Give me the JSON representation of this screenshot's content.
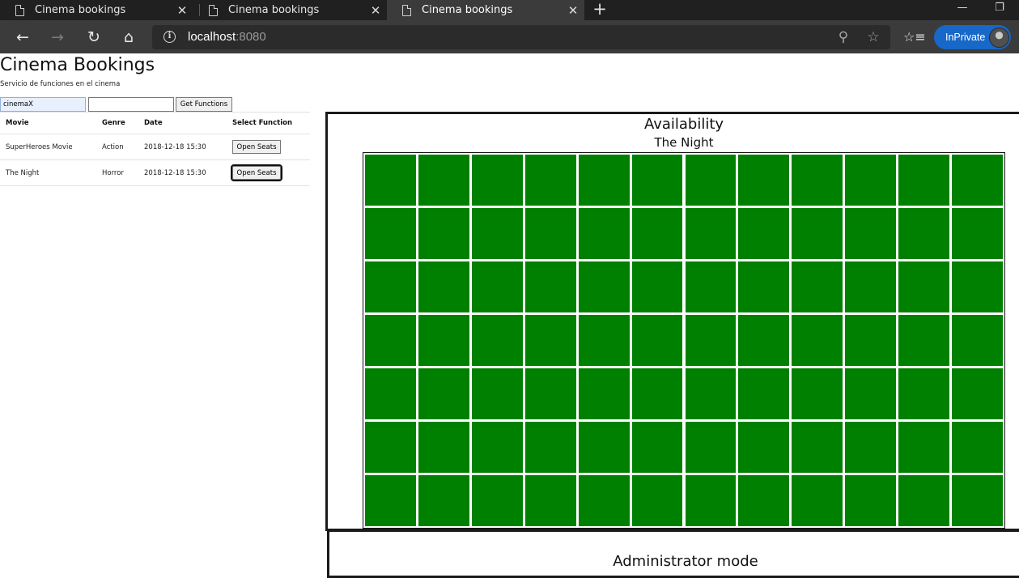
{
  "browser": {
    "tabs": [
      {
        "title": "Cinema bookings",
        "active": false
      },
      {
        "title": "Cinema bookings",
        "active": false
      },
      {
        "title": "Cinema bookings",
        "active": true
      }
    ],
    "url_host": "localhost",
    "url_port": ":8080",
    "inprivate_label": "InPrivate",
    "icons": {
      "tab": "page-icon",
      "close": "close-icon",
      "new_tab": "plus-icon",
      "back": "back-arrow-icon",
      "forward": "forward-arrow-icon",
      "refresh": "refresh-icon",
      "home": "home-icon",
      "site_info": "info-icon",
      "zoom": "zoom-icon",
      "favorite": "star-icon",
      "favorites_list": "favorites-icon"
    }
  },
  "page": {
    "title": "Cinema Bookings",
    "subtitle": "Servicio de funciones en el cinema",
    "cinema_input_value": "cinemaX",
    "date_input_value": "",
    "get_functions_label": "Get Functions",
    "table": {
      "headers": {
        "movie": "Movie",
        "genre": "Genre",
        "date": "Date",
        "select": "Select Function"
      },
      "rows": [
        {
          "movie": "SuperHeroes Movie",
          "genre": "Action",
          "date": "2018-12-18 15:30",
          "button": "Open Seats"
        },
        {
          "movie": "The Night",
          "genre": "Horror",
          "date": "2018-12-18 15:30",
          "button": "Open Seats"
        }
      ]
    },
    "availability": {
      "title": "Availability",
      "movie": "The Night",
      "rows": 7,
      "cols": 12,
      "seat_color": "#008000",
      "all_seats_available": true
    },
    "admin": {
      "title": "Administrator mode"
    }
  }
}
